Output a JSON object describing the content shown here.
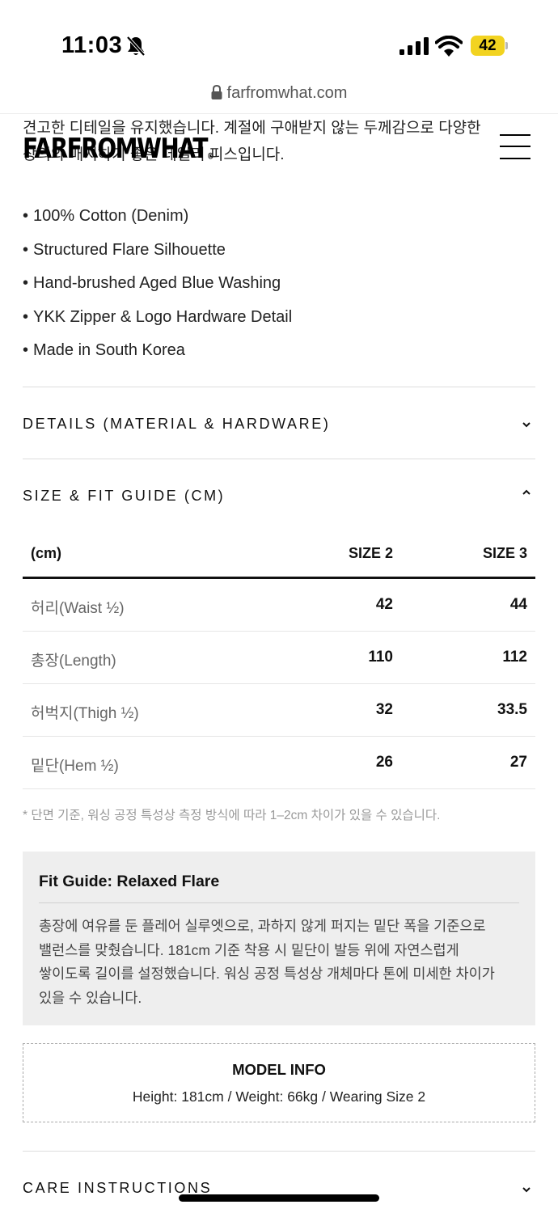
{
  "status_bar": {
    "time": "11:03",
    "battery": "42",
    "icons": [
      "bell-slash-icon",
      "cellular-signal-icon",
      "wifi-icon",
      "battery-icon"
    ],
    "battery_color": "#f2d320"
  },
  "browser": {
    "url": "farfromwhat.com",
    "icon": "lock-icon"
  },
  "header": {
    "logo": "FARFROMWHAT",
    "logo_mark": "®",
    "menu_icon": "hamburger-menu-icon"
  },
  "description": {
    "intro_lines": [
      "견고한 디테일을 유지했습니다. 계절에 구애받지 않는 두께감으로 다양한",
      "상의와 매치하기 좋은 데일리 피스입니다."
    ],
    "bullets": [
      "100% Cotton (Denim)",
      "Structured Flare Silhouette",
      "Hand-brushed Aged Blue Washing",
      "YKK Zipper & Logo Hardware Detail",
      "Made in South Korea"
    ]
  },
  "accordions": {
    "details": {
      "title": "DETAILS (MATERIAL & HARDWARE)",
      "icon": "chevron-down-icon",
      "expanded": false
    },
    "size_fit": {
      "title": "SIZE & FIT GUIDE (CM)",
      "icon": "chevron-up-icon",
      "expanded": true
    },
    "care": {
      "title": "CARE INSTRUCTIONS",
      "icon": "chevron-down-icon",
      "expanded": false
    }
  },
  "size_table": {
    "headers": [
      "(cm)",
      "SIZE 2",
      "SIZE 3"
    ],
    "rows": [
      {
        "label": "허리(Waist ½)",
        "size2": "42",
        "size3": "44"
      },
      {
        "label": "총장(Length)",
        "size2": "110",
        "size3": "112"
      },
      {
        "label": "허벅지(Thigh ½)",
        "size2": "32",
        "size3": "33.5"
      },
      {
        "label": "밑단(Hem ½)",
        "size2": "26",
        "size3": "27"
      }
    ],
    "note": "* 단면 기준, 워싱 공정 특성상 측정 방식에 따라 1–2cm 차이가 있을 수 있습니다."
  },
  "fit_guide": {
    "title": "Fit Guide: Relaxed Flare",
    "lines": [
      "총장에 여유를 둔 플레어 실루엣으로, 과하지 않게 퍼지는 밑단 폭을 기준으로",
      "밸런스를 맞췄습니다. 181cm 기준 착용 시 밑단이 발등 위에 자연스럽게",
      "쌓이도록 길이를 설정했습니다. 워싱 공정 특성상 개체마다 톤에 미세한 차이가",
      "있을 수 있습니다."
    ]
  },
  "model_info": {
    "title": "MODEL INFO",
    "body": "Height: 181cm / Weight: 66kg / Wearing Size 2"
  }
}
